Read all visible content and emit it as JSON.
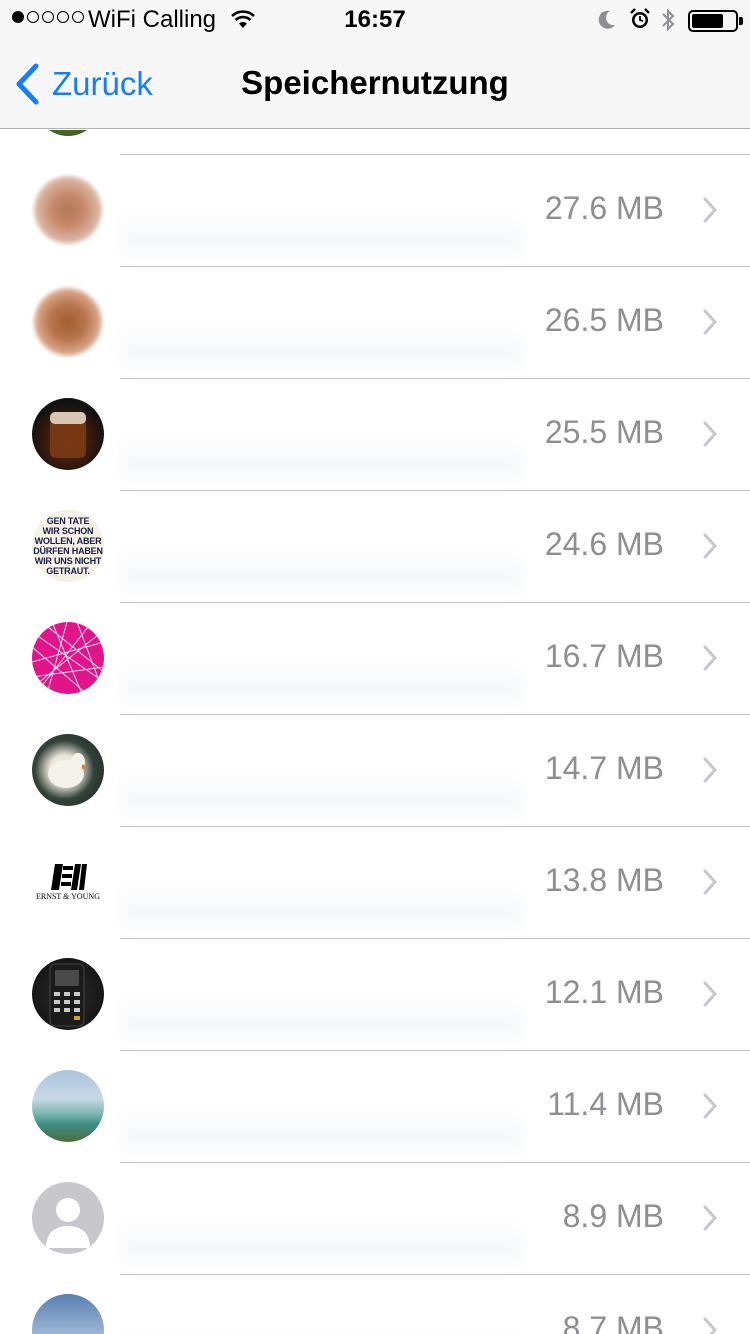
{
  "status_bar": {
    "carrier": "WiFi Calling",
    "time": "16:57"
  },
  "nav": {
    "back_label": "Zurück",
    "title": "Speichernutzung"
  },
  "colors": {
    "accent": "#157efb",
    "size_text": "#8e8e93",
    "separator": "#c8c7cc",
    "nav_background": "#f7f7f7"
  },
  "rows": [
    {
      "size": "27.6 MB",
      "avatar": "blurred-food-photo"
    },
    {
      "size": "26.5 MB",
      "avatar": "blurred-food-photo"
    },
    {
      "size": "25.5 MB",
      "avatar": "beer-glass-photo"
    },
    {
      "size": "24.6 MB",
      "avatar": "quote-text-image",
      "avatar_text": "GEN TATE\nWIR SCHON\nWOLLEN, ABER\nDÜRFEN HABEN\nWIR UNS NICHT\nGETRAUT."
    },
    {
      "size": "16.7 MB",
      "avatar": "pink-lines-pattern"
    },
    {
      "size": "14.7 MB",
      "avatar": "swan-photo"
    },
    {
      "size": "13.8 MB",
      "avatar": "ernst-young-logo",
      "avatar_text": "ERNST & YOUNG"
    },
    {
      "size": "12.1 MB",
      "avatar": "calculator-photo"
    },
    {
      "size": "11.4 MB",
      "avatar": "sea-landscape-photo"
    },
    {
      "size": "8.9 MB",
      "avatar": "default-person-placeholder"
    },
    {
      "size": "8.7 MB",
      "avatar": "cityscape-photo"
    }
  ]
}
